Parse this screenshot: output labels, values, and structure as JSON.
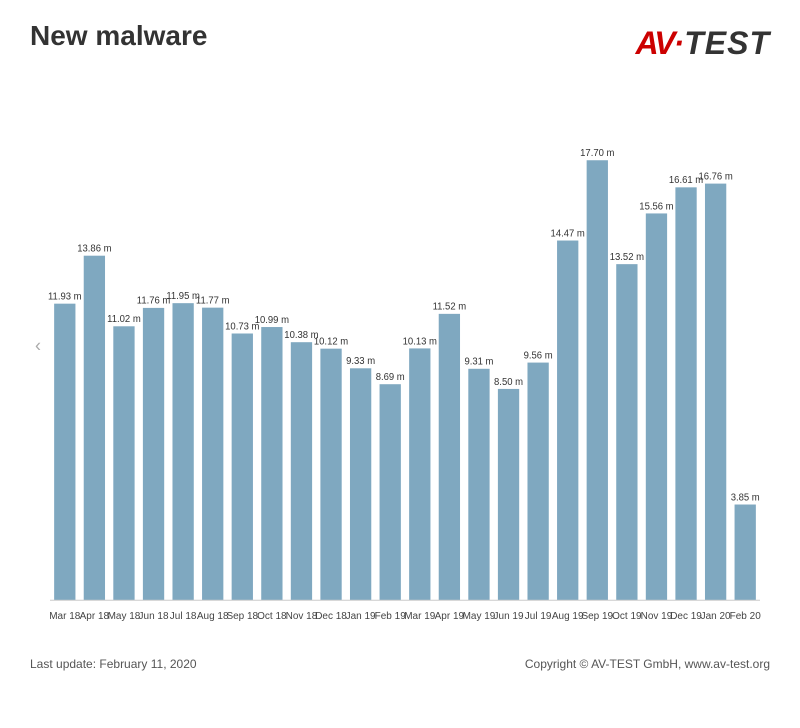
{
  "title": "New malware",
  "logo": {
    "av": "AV",
    "test": "TEST"
  },
  "chart": {
    "bars": [
      {
        "label": "Mar 18",
        "value": 11.93,
        "display": "11.93 m"
      },
      {
        "label": "Apr 18",
        "value": 13.86,
        "display": "13.86 m"
      },
      {
        "label": "May 18",
        "value": 11.02,
        "display": "11.02 m"
      },
      {
        "label": "Jun 18",
        "value": 11.76,
        "display": "11.76 m"
      },
      {
        "label": "Jul 18",
        "value": 11.95,
        "display": "11.95 m"
      },
      {
        "label": "Aug 18",
        "value": 11.77,
        "display": "11.77 m"
      },
      {
        "label": "Sep 18",
        "value": 10.73,
        "display": "10.73 m"
      },
      {
        "label": "Oct 18",
        "value": 10.99,
        "display": "10.99 m"
      },
      {
        "label": "Nov 18",
        "value": 10.38,
        "display": "10.38 m"
      },
      {
        "label": "Dec 18",
        "value": 10.12,
        "display": "10.12 m"
      },
      {
        "label": "Jan 19",
        "value": 9.33,
        "display": "9.33 m"
      },
      {
        "label": "Feb 19",
        "value": 8.69,
        "display": "8.69 m"
      },
      {
        "label": "Mar 19",
        "value": 10.13,
        "display": "10.13 m"
      },
      {
        "label": "Apr 19",
        "value": 11.52,
        "display": "11.52 m"
      },
      {
        "label": "May 19",
        "value": 9.31,
        "display": "9.31 m"
      },
      {
        "label": "Jun 19",
        "value": 8.5,
        "display": "8.50 m"
      },
      {
        "label": "Jul 19",
        "value": 9.56,
        "display": "9.56 m"
      },
      {
        "label": "Aug 19",
        "value": 14.47,
        "display": "14.47 m"
      },
      {
        "label": "Sep 19",
        "value": 17.7,
        "display": "17.70 m"
      },
      {
        "label": "Oct 19",
        "value": 13.52,
        "display": "13.52 m"
      },
      {
        "label": "Nov 19",
        "value": 15.56,
        "display": "15.56 m"
      },
      {
        "label": "Dec 19",
        "value": 16.61,
        "display": "16.61 m"
      },
      {
        "label": "Jan 20",
        "value": 16.76,
        "display": "16.76 m"
      },
      {
        "label": "Feb 20",
        "value": 3.85,
        "display": "3.85 m"
      }
    ],
    "maxValue": 20,
    "barColor": "#7fa8c0",
    "labelFontSize": 11
  },
  "footer": {
    "lastUpdate": "Last update: February 11, 2020",
    "copyright": "Copyright © AV-TEST GmbH, www.av-test.org"
  }
}
